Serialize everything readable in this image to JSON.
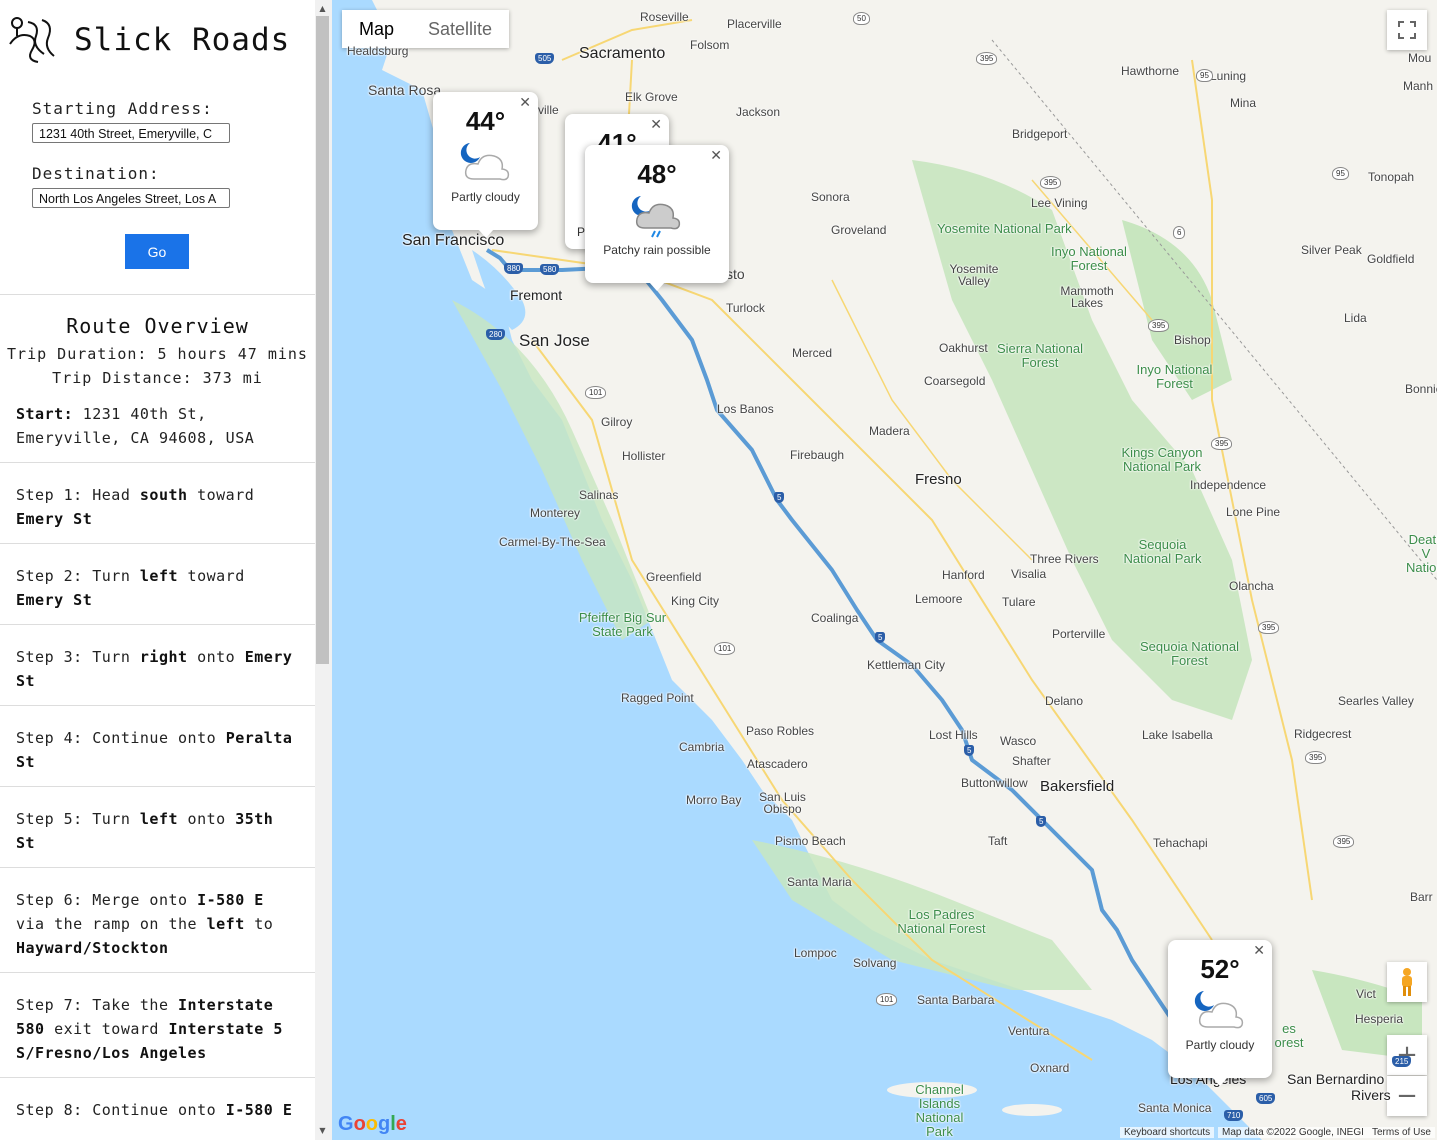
{
  "app": {
    "title": "Slick Roads",
    "logo_icon": "road-logo-icon"
  },
  "form": {
    "start_label": "Starting Address:",
    "start_value": "1231 40th Street, Emeryville, C",
    "dest_label": "Destination:",
    "dest_value": "North Los Angeles Street, Los A",
    "go_label": "Go"
  },
  "overview": {
    "title": "Route Overview",
    "duration": "Trip Duration: 5 hours 47 mins",
    "distance": "Trip Distance: 373 mi",
    "start_label": "Start:",
    "start_address": "1231 40th St, Emeryville, CA 94608, USA"
  },
  "steps": [
    {
      "prefix": "Step 1: Head ",
      "bold1": "south",
      "mid": " toward ",
      "bold2": "Emery St",
      "suffix": ""
    },
    {
      "prefix": "Step 2: Turn ",
      "bold1": "left",
      "mid": " toward ",
      "bold2": "Emery St",
      "suffix": ""
    },
    {
      "prefix": "Step 3: Turn ",
      "bold1": "right",
      "mid": " onto ",
      "bold2": "Emery St",
      "suffix": ""
    },
    {
      "prefix": "Step 4: Continue onto ",
      "bold1": "Peralta St",
      "mid": "",
      "bold2": "",
      "suffix": ""
    },
    {
      "prefix": "Step 5: Turn ",
      "bold1": "left",
      "mid": " onto ",
      "bold2": "35th St",
      "suffix": ""
    },
    {
      "prefix": "Step 6: Merge onto ",
      "bold1": "I-580 E",
      "mid": " via the ramp on the ",
      "bold2": "left",
      "suffix": " to ",
      "bold3": "Hayward/Stockton"
    },
    {
      "prefix": "Step 7: Take the ",
      "bold1": "Interstate 580",
      "mid": " exit toward ",
      "bold2": "Interstate 5 S/Fresno/Los Angeles",
      "suffix": ""
    },
    {
      "prefix": "Step 8: Continue onto ",
      "bold1": "I-580 E",
      "mid": "",
      "bold2": "",
      "suffix": ""
    }
  ],
  "map": {
    "type_tabs": [
      "Map",
      "Satellite"
    ],
    "active_tab": "Map",
    "route_color": "#5b9bd5",
    "water_color": "#aadaff",
    "land_color": "#f4f3ee",
    "park_color": "#c8e6bf",
    "weather_popups": [
      {
        "temp": "44°",
        "condition": "Partly cloudy",
        "icon": "moon-cloud-icon"
      },
      {
        "temp": "41°",
        "condition": "P",
        "icon": "moon-cloud-icon"
      },
      {
        "temp": "48°",
        "condition": "Patchy rain possible",
        "icon": "moon-rain-cloud-icon"
      },
      {
        "temp": "52°",
        "condition": "Partly cloudy",
        "icon": "moon-cloud-icon"
      }
    ],
    "places": {
      "roseville": "Roseville",
      "placerville": "Placerville",
      "sacramento": "Sacramento",
      "folsom": "Folsom",
      "healdsburg": "Healdsburg",
      "santa_rosa": "Santa Rosa",
      "elk_grove": "Elk Grove",
      "jackson": "Jackson",
      "hawthorne": "Hawthorne",
      "luning": "Luning",
      "mina": "Mina",
      "bridgeport": "Bridgeport",
      "lee_vining": "Lee Vining",
      "tonopah": "Tonopah",
      "sonora": "Sonora",
      "groveland": "Groveland",
      "yosemite_np": "Yosemite National Park",
      "yosemite_valley": "Yosemite Valley",
      "inyo_nf1": "Inyo National Forest",
      "mammoth": "Mammoth Lakes",
      "silver_peak": "Silver Peak",
      "goldfield": "Goldfield",
      "lida": "Lida",
      "san_francisco": "San Francisco",
      "fremont": "Fremont",
      "san_jose": "San Jose",
      "sto": "sto",
      "ville": "ville",
      "turlock": "Turlock",
      "merced": "Merced",
      "oakhurst": "Oakhurst",
      "sierra_nf": "Sierra National Forest",
      "coarsegold": "Coarsegold",
      "bishop": "Bishop",
      "inyo_nf2": "Inyo National Forest",
      "bonnie": "Bonnie C",
      "los_banos": "Los Banos",
      "gilroy": "Gilroy",
      "madera": "Madera",
      "hollister": "Hollister",
      "firebaugh": "Firebaugh",
      "fresno": "Fresno",
      "kings_canyon": "Kings Canyon National Park",
      "independence": "Independence",
      "salinas": "Salinas",
      "monterey": "Monterey",
      "carmel": "Carmel-By-The-Sea",
      "lone_pine": "Lone Pine",
      "death_valley": "Death V Nationa",
      "three_rivers": "Three Rivers",
      "sequoia_np": "Sequoia National Park",
      "greenfield": "Greenfield",
      "hanford": "Hanford",
      "visalia": "Visalia",
      "king_city": "King City",
      "lemoore": "Lemoore",
      "tulare": "Tulare",
      "olancha": "Olancha",
      "pfeiffer": "Pfeiffer Big Sur State Park",
      "coalinga": "Coalinga",
      "porterville": "Porterville",
      "sequoia_nf": "Sequoia National Forest",
      "kettleman": "Kettleman City",
      "ragged_point": "Ragged Point",
      "delano": "Delano",
      "searles": "Searles Valley",
      "paso_robles": "Paso Robles",
      "cambria": "Cambria",
      "lost_hills": "Lost Hills",
      "wasco": "Wasco",
      "lake_isabella": "Lake Isabella",
      "ridgecrest": "Ridgecrest",
      "atascadero": "Atascadero",
      "shafter": "Shafter",
      "buttonwillow": "Buttonwillow",
      "bakersfield": "Bakersfield",
      "morro_bay": "Morro Bay",
      "san_luis_obispo": "San Luis Obispo",
      "taft": "Taft",
      "tehachapi": "Tehachapi",
      "pismo": "Pismo Beach",
      "santa_maria": "Santa Maria",
      "los_padres": "Los Padres National Forest",
      "lompoc": "Lompoc",
      "solvang": "Solvang",
      "victorville": "Vict",
      "hesperia": "Hesperia",
      "santa_barbara": "Santa Barbara",
      "ventura": "Ventura",
      "oxnard": "Oxnard",
      "channel_islands": "Channel Islands National Park",
      "san_bernardino": "San Bernardino",
      "riverside": "Rivers",
      "santa_monica": "Santa Monica",
      "los_angeles": "Los Angeles",
      "es_forest": "es orest",
      "barr": "Barr",
      "mou": "Mou",
      "manh": "Manh"
    },
    "shields": {
      "i5": "5",
      "i580": "580",
      "i880": "880",
      "i280": "280",
      "us50": "50",
      "us101": "101",
      "us395": "395",
      "us95": "95",
      "ca6": "6",
      "i505": "505",
      "i710": "710",
      "i605": "605",
      "i215": "215"
    },
    "attribution": {
      "shortcuts": "Keyboard shortcuts",
      "data": "Map data ©2022 Google, INEGI",
      "terms": "Terms of Use"
    },
    "google_logo": "Google",
    "controls": {
      "fullscreen_icon": "fullscreen-icon",
      "pegman_icon": "pegman-icon",
      "zoom_in": "+",
      "zoom_out": "−"
    }
  }
}
